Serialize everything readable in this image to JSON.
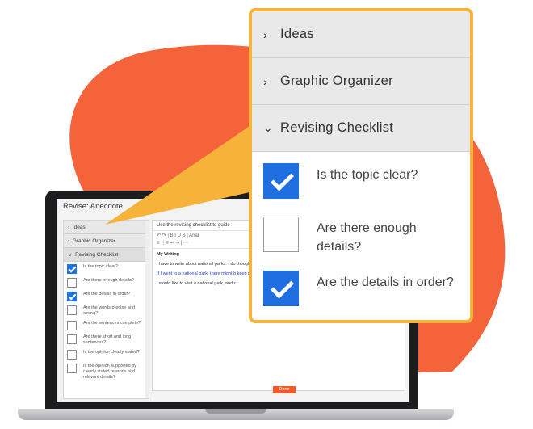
{
  "colors": {
    "blob": "#f4633a",
    "popup_border": "#f7b23a",
    "checkbox_checked": "#1f6fe0",
    "done_button": "#f05a28"
  },
  "popup": {
    "sections": [
      {
        "label": "Ideas",
        "expanded": false,
        "icon": "chevron-right-icon"
      },
      {
        "label": "Graphic Organizer",
        "expanded": false,
        "icon": "chevron-right-icon"
      },
      {
        "label": "Revising Checklist",
        "expanded": true,
        "icon": "chevron-down-icon"
      }
    ],
    "checklist": [
      {
        "label": "Is the topic clear?",
        "checked": true
      },
      {
        "label": "Are there enough details?",
        "checked": false
      },
      {
        "label": "Are the details in order?",
        "checked": true
      }
    ]
  },
  "laptop": {
    "window_title": "Revise: Anecdote",
    "panel": {
      "sections": [
        "Ideas",
        "Graphic Organizer",
        "Revising Checklist"
      ],
      "items": [
        {
          "label": "Is the topic clear?",
          "checked": true
        },
        {
          "label": "Are there enough details?",
          "checked": false
        },
        {
          "label": "Are the details in order?",
          "checked": true
        },
        {
          "label": "Are the words precise and strong?",
          "checked": false
        },
        {
          "label": "Are the sentences complete?",
          "checked": false
        },
        {
          "label": "Are there short and long sentences?",
          "checked": false
        },
        {
          "label": "Is the opinion clearly stated?",
          "checked": false
        },
        {
          "label": "Is the opinion supported by clearly stated reasons and relevant details?",
          "checked": false
        }
      ]
    },
    "editor": {
      "instruction": "Use the revising checklist to guide",
      "toolbar_row1": "↶ ↷ | B I U S | Arial",
      "toolbar_row2": "≡ ⋮≡ ⇤ ⇥ | ⋯",
      "heading": "My Writing",
      "para1": "I have to write about national parks. I do though. They have trees and grass and",
      "para2": "If I went to a national park, there might b keep us safe and help us not ruin the pa maybe they would give us candy.",
      "para3": "I would like to visit a national park, and r"
    },
    "done_label": "Done"
  }
}
